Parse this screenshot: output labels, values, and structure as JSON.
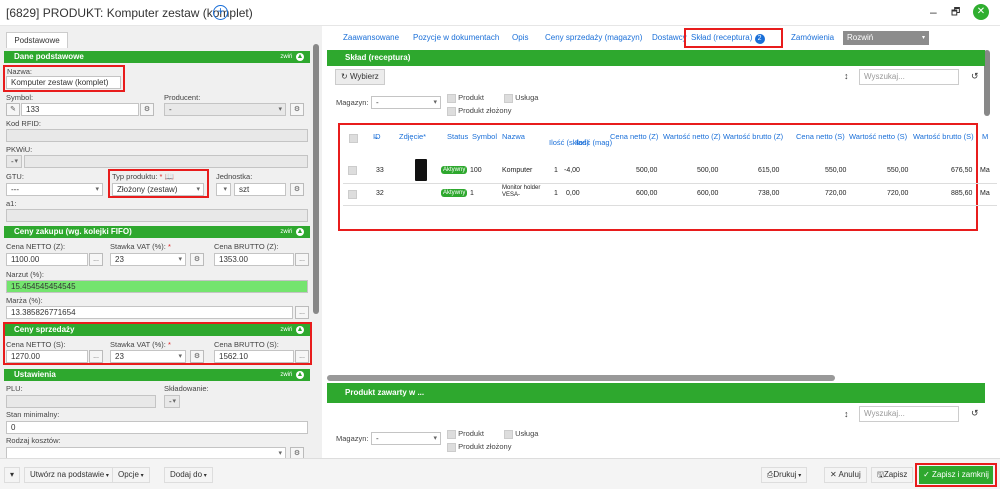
{
  "window": {
    "title": "[6829] PRODUKT: Komputer zestaw (komplet)",
    "add_icon": "plus-circle-icon",
    "min_glyph": "–",
    "max_glyph": "🗗",
    "close_glyph": "✕"
  },
  "left": {
    "tab": "Podstawowe",
    "sections": {
      "dane": "Dane podstawowe",
      "ceny_zakupu": "Ceny zakupu (wg. kolejki FIFO)",
      "ceny_sprzedazy": "Ceny sprzedaży",
      "ustawienia": "Ustawienia",
      "hide_label": "zwiń"
    },
    "fields": {
      "nazwa_label": "Nazwa:",
      "nazwa_value": "Komputer zestaw (komplet)",
      "symbol_label": "Symbol:",
      "symbol_value": "133",
      "producent_label": "Producent:",
      "producent_value": "-",
      "rfid_label": "Kod RFID:",
      "pkwiu_label": "PKWiU:",
      "pkwiu_value": "-",
      "gtu_label": "GTU:",
      "gtu_value": "---",
      "typ_label": "Typ produktu:",
      "typ_value": "Złożony (zestaw)",
      "jednostka_label": "Jednostka:",
      "jednostka_value": "szt",
      "a1_label": "a1:",
      "zak_netto_label": "Cena NETTO (Z):",
      "zak_netto_value": "1100.00",
      "zak_vat_label": "Stawka VAT (%):",
      "zak_vat_value": "23",
      "zak_brutto_label": "Cena BRUTTO (Z):",
      "zak_brutto_value": "1353.00",
      "narzut_label": "Narzut (%):",
      "narzut_value": "15.454545454545",
      "marza_label": "Marża (%):",
      "marza_value": "13.385826771654",
      "sp_netto_label": "Cena NETTO (S):",
      "sp_netto_value": "1270.00",
      "sp_vat_label": "Stawka VAT (%):",
      "sp_vat_value": "23",
      "sp_brutto_label": "Cena BRUTTO (S):",
      "sp_brutto_value": "1562.10",
      "plu_label": "PLU:",
      "skladowanie_label": "Składowanie:",
      "skladowanie_value": "-",
      "stan_label": "Stan minimalny:",
      "stan_value": "0",
      "koszty_label": "Rodzaj kosztów:"
    }
  },
  "right": {
    "tabs": [
      "Zaawansowane",
      "Pozycje w dokumentach",
      "Opis",
      "Ceny sprzedaży (magazyn)",
      "Dostawcy",
      "Skład (receptura)",
      "Zamówienia"
    ],
    "active_badge": "2",
    "rozwin": "Rozwiń",
    "section_title": "Skład (receptura)",
    "wybierz": "Wybierz",
    "search_placeholder": "Wyszukaj...",
    "magazyn_label": "Magazyn:",
    "magazyn_value": "-",
    "produkt_chk": "Produkt",
    "usluga_chk": "Usługa",
    "zlozony_chk": "Produkt złożony",
    "columns": [
      "ID",
      "Zdjęcie*",
      "Status",
      "Symbol",
      "Nazwa",
      "Ilość (skład)",
      "Ilość (mag)",
      "Cena netto (Z)",
      "Wartość netto (Z)",
      "Wartość brutto (Z)",
      "Cena netto (S)",
      "Wartość netto (S)",
      "Wartość brutto (S)",
      "M"
    ],
    "rows": [
      {
        "id": "33",
        "status": "Aktywny",
        "symbol": "100",
        "nazwa": "Komputer",
        "ilosc_sklad": "1",
        "ilosc_mag": "-4,00",
        "cn_z": "500,00",
        "wn_z": "500,00",
        "wb_z": "615,00",
        "cn_s": "550,00",
        "wn_s": "550,00",
        "wb_s": "676,50",
        "m": "Ma"
      },
      {
        "id": "32",
        "status": "Aktywny",
        "symbol": "1",
        "nazwa": "Monitor holder VESA-",
        "ilosc_sklad": "1",
        "ilosc_mag": "0,00",
        "cn_z": "600,00",
        "wn_z": "600,00",
        "wb_z": "738,00",
        "cn_s": "720,00",
        "wn_s": "720,00",
        "wb_s": "885,60",
        "m": "Ma"
      }
    ],
    "second_section_title": "Produkt zawarty w ..."
  },
  "bottom": {
    "utworz": "Utwórz na podstawie",
    "opcje": "Opcje",
    "dodaj": "Dodaj do",
    "drukuj": "Drukuj",
    "anuluj": "Anuluj",
    "zapisz": "Zapisz",
    "zapisz_zamknij": "Zapisz i zamknij"
  },
  "colors": {
    "accent_green": "#2ea82e",
    "highlight_red": "#e81c1c",
    "link_blue": "#1a6fd8"
  }
}
